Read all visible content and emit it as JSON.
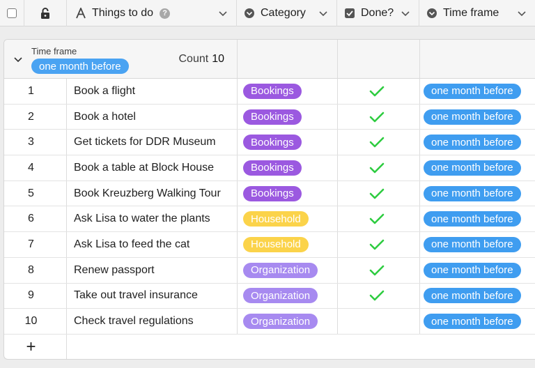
{
  "header": {
    "things_label": "Things to do",
    "category_label": "Category",
    "done_label": "Done?",
    "timeframe_label": "Time frame"
  },
  "group": {
    "label": "Time frame",
    "value": "one month before",
    "count_label": "Count",
    "count": "10"
  },
  "category_colors": {
    "Bookings": {
      "bg": "#9b59e0",
      "fg": "#ffffff"
    },
    "Household": {
      "bg": "#fbd34a",
      "fg": "#ffffff"
    },
    "Organization": {
      "bg": "#a78af0",
      "fg": "#ffffff"
    }
  },
  "check_color": "#2ecc40",
  "rows": [
    {
      "num": "1",
      "task": "Book a flight",
      "category": "Bookings",
      "done": true,
      "timeframe": "one month before"
    },
    {
      "num": "2",
      "task": "Book a hotel",
      "category": "Bookings",
      "done": true,
      "timeframe": "one month before"
    },
    {
      "num": "3",
      "task": "Get tickets for DDR Museum",
      "category": "Bookings",
      "done": true,
      "timeframe": "one month before"
    },
    {
      "num": "4",
      "task": "Book a table at Block House",
      "category": "Bookings",
      "done": true,
      "timeframe": "one month before"
    },
    {
      "num": "5",
      "task": "Book Kreuzberg Walking Tour",
      "category": "Bookings",
      "done": true,
      "timeframe": "one month before"
    },
    {
      "num": "6",
      "task": "Ask Lisa to water the plants",
      "category": "Household",
      "done": true,
      "timeframe": "one month before"
    },
    {
      "num": "7",
      "task": "Ask Lisa to feed the cat",
      "category": "Household",
      "done": true,
      "timeframe": "one month before"
    },
    {
      "num": "8",
      "task": "Renew passport",
      "category": "Organization",
      "done": true,
      "timeframe": "one month before"
    },
    {
      "num": "9",
      "task": "Take out travel insurance",
      "category": "Organization",
      "done": true,
      "timeframe": "one month before"
    },
    {
      "num": "10",
      "task": "Check travel regulations",
      "category": "Organization",
      "done": false,
      "timeframe": "one month before"
    }
  ],
  "add_row_label": "+"
}
